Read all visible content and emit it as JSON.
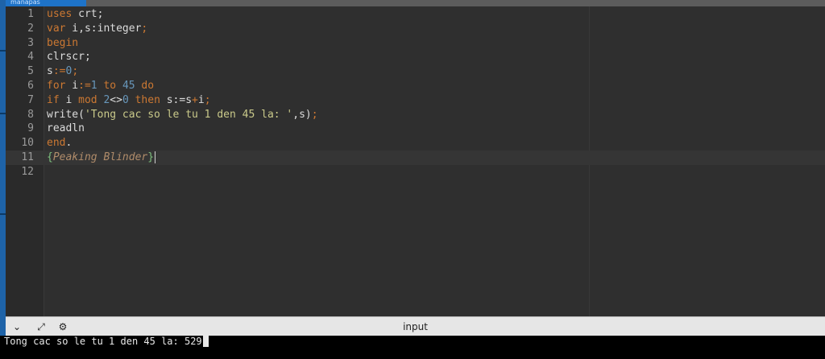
{
  "window": {
    "tab_label": "manapas"
  },
  "editor": {
    "lines": [
      {
        "num": "1",
        "tokens": [
          {
            "t": "uses",
            "c": "kw"
          },
          {
            "t": " crt;",
            "c": "plain"
          }
        ]
      },
      {
        "num": "2",
        "tokens": [
          {
            "t": "var",
            "c": "kw"
          },
          {
            "t": " i,s:integer",
            "c": "plain"
          },
          {
            "t": ";",
            "c": "kw"
          }
        ]
      },
      {
        "num": "3",
        "tokens": [
          {
            "t": "begin",
            "c": "kw"
          }
        ]
      },
      {
        "num": "4",
        "tokens": [
          {
            "t": "clrscr;",
            "c": "plain"
          }
        ]
      },
      {
        "num": "5",
        "tokens": [
          {
            "t": "s",
            "c": "plain"
          },
          {
            "t": ":=",
            "c": "kw"
          },
          {
            "t": "0",
            "c": "num"
          },
          {
            "t": ";",
            "c": "kw"
          }
        ]
      },
      {
        "num": "6",
        "tokens": [
          {
            "t": "for",
            "c": "kw"
          },
          {
            "t": " i",
            "c": "plain"
          },
          {
            "t": ":=",
            "c": "kw"
          },
          {
            "t": "1",
            "c": "num"
          },
          {
            "t": " to ",
            "c": "kw"
          },
          {
            "t": "45",
            "c": "num"
          },
          {
            "t": " do",
            "c": "kw"
          }
        ]
      },
      {
        "num": "7",
        "tokens": [
          {
            "t": "if",
            "c": "kw"
          },
          {
            "t": " i ",
            "c": "plain"
          },
          {
            "t": "mod",
            "c": "kw"
          },
          {
            "t": " ",
            "c": "plain"
          },
          {
            "t": "2",
            "c": "num"
          },
          {
            "t": "<>",
            "c": "plain"
          },
          {
            "t": "0",
            "c": "num"
          },
          {
            "t": " then",
            "c": "kw"
          },
          {
            "t": " s:=s",
            "c": "plain"
          },
          {
            "t": "+",
            "c": "kw"
          },
          {
            "t": "i",
            "c": "plain"
          },
          {
            "t": ";",
            "c": "kw"
          }
        ]
      },
      {
        "num": "8",
        "tokens": [
          {
            "t": "write(",
            "c": "plain"
          },
          {
            "t": "'Tong cac so le tu 1 den 45 la: '",
            "c": "str"
          },
          {
            "t": ",s)",
            "c": "plain"
          },
          {
            "t": ";",
            "c": "kw"
          }
        ]
      },
      {
        "num": "9",
        "tokens": [
          {
            "t": "readln",
            "c": "plain"
          }
        ]
      },
      {
        "num": "10",
        "tokens": [
          {
            "t": "end",
            "c": "kw"
          },
          {
            "t": ".",
            "c": "plain"
          }
        ]
      },
      {
        "num": "11",
        "tokens": [
          {
            "t": "{",
            "c": "brace"
          },
          {
            "t": "Peaking Blinder",
            "c": "cmt"
          },
          {
            "t": "}",
            "c": "brace"
          }
        ],
        "current": true
      },
      {
        "num": "12",
        "tokens": []
      }
    ]
  },
  "panel": {
    "title": "input",
    "buttons": [
      {
        "name": "collapse-chevron-icon",
        "glyph": "⌄"
      },
      {
        "name": "expand-arrows-icon",
        "glyph": "⤢"
      },
      {
        "name": "run-settings-icon",
        "glyph": "⚙"
      }
    ]
  },
  "console": {
    "output": "Tong cac so le tu 1 den 45 la: 529"
  }
}
